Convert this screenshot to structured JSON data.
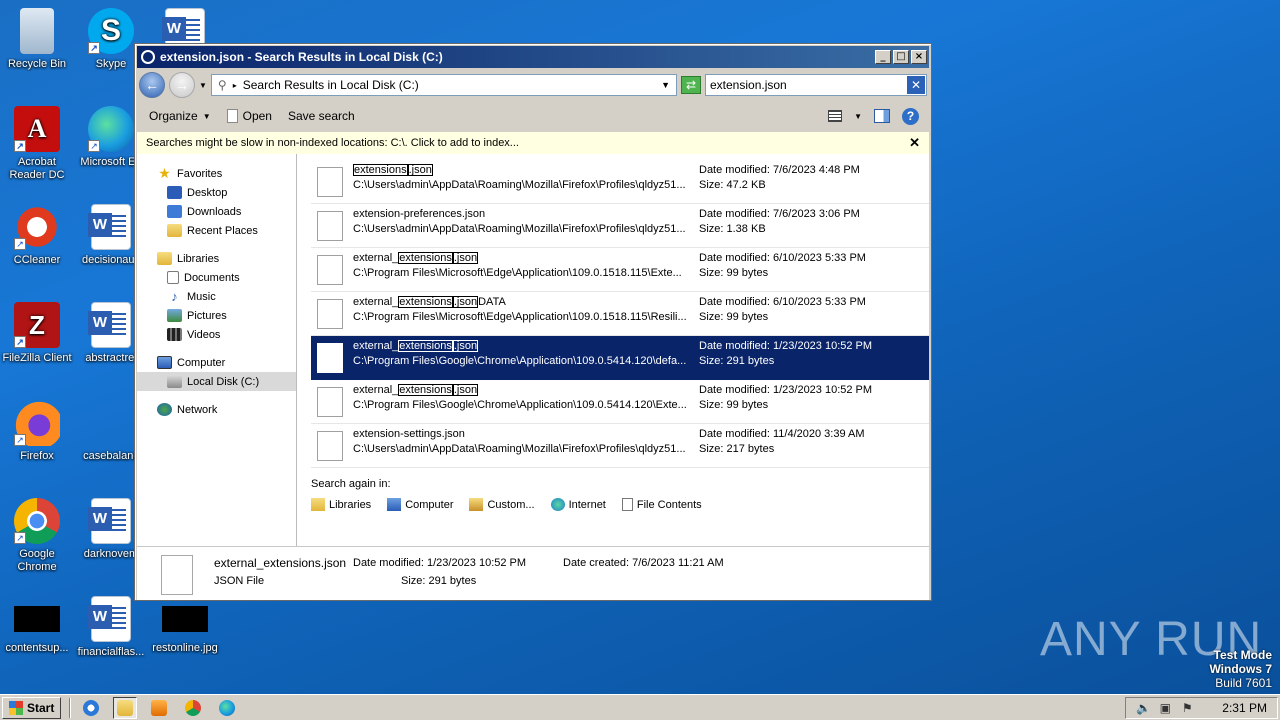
{
  "desktop": {
    "icons": [
      {
        "label": "Recycle Bin"
      },
      {
        "label": "Skype"
      },
      {
        "label": "Acrobat Reader DC"
      },
      {
        "label": "Microsoft Ed"
      },
      {
        "label": "CCleaner"
      },
      {
        "label": "decisionaus"
      },
      {
        "label": "FileZilla Client"
      },
      {
        "label": "abstractrel"
      },
      {
        "label": "Firefox"
      },
      {
        "label": "casebalanc"
      },
      {
        "label": "Google Chrome"
      },
      {
        "label": "darknovem"
      },
      {
        "label": "contentsup..."
      },
      {
        "label": "financialflas..."
      },
      {
        "label": "restonline.jpg"
      }
    ]
  },
  "window": {
    "title": "extension.json - Search Results in Local Disk (C:)",
    "address": "Search Results in Local Disk (C:)",
    "search_value": "extension.json",
    "toolbar": {
      "organize": "Organize",
      "open": "Open",
      "save_search": "Save search"
    },
    "infobar": "Searches might be slow in non-indexed locations: C:\\. Click to add to index...",
    "nav": {
      "favorites": "Favorites",
      "desktop": "Desktop",
      "downloads": "Downloads",
      "recent": "Recent Places",
      "libraries": "Libraries",
      "documents": "Documents",
      "music": "Music",
      "pictures": "Pictures",
      "videos": "Videos",
      "computer": "Computer",
      "local_disk": "Local Disk (C:)",
      "network": "Network"
    },
    "results": [
      {
        "name_parts": [
          "",
          "extensions",
          ".json",
          ""
        ],
        "path": "C:\\Users\\admin\\AppData\\Roaming\\Mozilla\\Firefox\\Profiles\\qldyz51...",
        "modified": "Date modified: 7/6/2023 4:48 PM",
        "size": "Size: 47.2 KB"
      },
      {
        "name_parts": [
          "extension-preferences.json",
          "",
          "",
          ""
        ],
        "path": "C:\\Users\\admin\\AppData\\Roaming\\Mozilla\\Firefox\\Profiles\\qldyz51...",
        "modified": "Date modified: 7/6/2023 3:06 PM",
        "size": "Size: 1.38 KB"
      },
      {
        "name_parts": [
          "external_",
          "extensions",
          ".json",
          ""
        ],
        "path": "C:\\Program Files\\Microsoft\\Edge\\Application\\109.0.1518.115\\Exte...",
        "modified": "Date modified: 6/10/2023 5:33 PM",
        "size": "Size: 99 bytes"
      },
      {
        "name_parts": [
          "external_",
          "extensions",
          ".json",
          "DATA"
        ],
        "path": "C:\\Program Files\\Microsoft\\Edge\\Application\\109.0.1518.115\\Resili...",
        "modified": "Date modified: 6/10/2023 5:33 PM",
        "size": "Size: 99 bytes"
      },
      {
        "name_parts": [
          "external_",
          "extensions",
          ".json",
          ""
        ],
        "path": "C:\\Program Files\\Google\\Chrome\\Application\\109.0.5414.120\\defa...",
        "modified": "Date modified: 1/23/2023 10:52 PM",
        "size": "Size: 291 bytes",
        "selected": true
      },
      {
        "name_parts": [
          "external_",
          "extensions",
          ".json",
          ""
        ],
        "path": "C:\\Program Files\\Google\\Chrome\\Application\\109.0.5414.120\\Exte...",
        "modified": "Date modified: 1/23/2023 10:52 PM",
        "size": "Size: 99 bytes"
      },
      {
        "name_parts": [
          "extension-settings.json",
          "",
          "",
          ""
        ],
        "path": "C:\\Users\\admin\\AppData\\Roaming\\Mozilla\\Firefox\\Profiles\\qldyz51...",
        "modified": "Date modified: 11/4/2020 3:39 AM",
        "size": "Size: 217 bytes"
      }
    ],
    "search_again": {
      "label": "Search again in:",
      "libraries": "Libraries",
      "computer": "Computer",
      "custom": "Custom...",
      "internet": "Internet",
      "file_contents": "File Contents"
    },
    "details": {
      "name": "external_extensions.json",
      "type": "JSON File",
      "modified": "Date modified:  1/23/2023 10:52 PM",
      "size": "Size:  291 bytes",
      "created": "Date created:  7/6/2023 11:21 AM"
    }
  },
  "taskbar": {
    "start": "Start",
    "clock": "2:31 PM"
  },
  "overlay": {
    "watermark": "ANY RUN",
    "test_mode": "Test Mode",
    "os": "Windows 7",
    "build": "Build 7601"
  }
}
